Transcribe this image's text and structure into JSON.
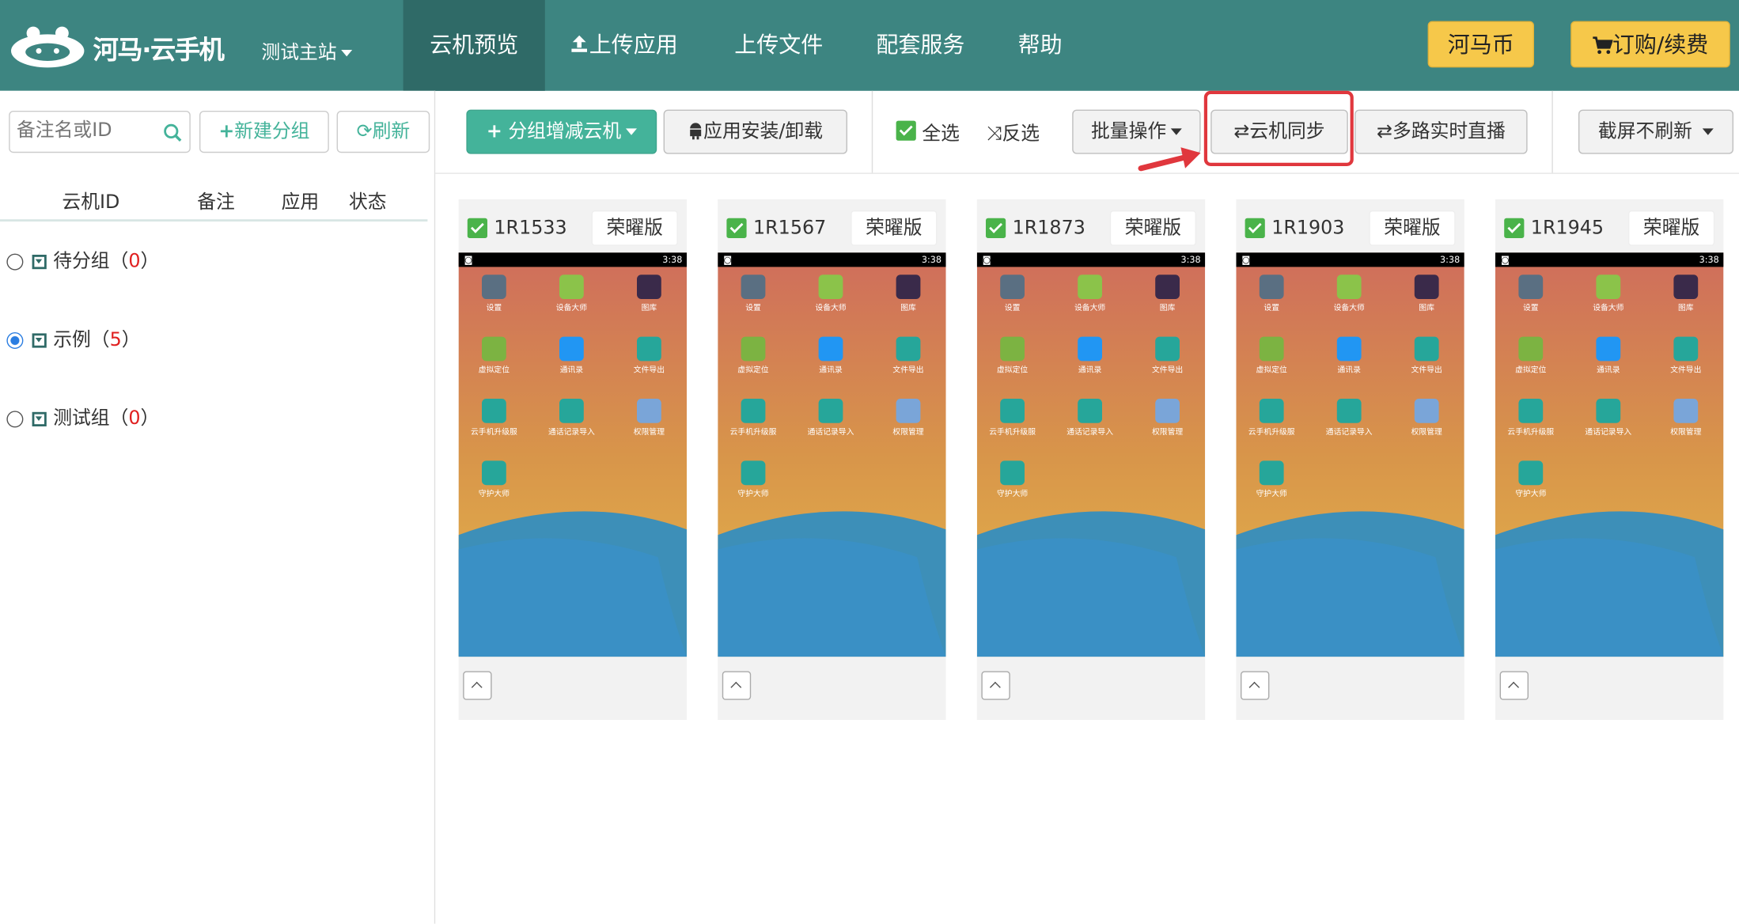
{
  "brand": {
    "logo_text": "河马·云手机",
    "site_selector": "测试主站"
  },
  "nav": [
    {
      "label": "云机预览",
      "active": true
    },
    {
      "label": "上传应用",
      "active": false
    },
    {
      "label": "上传文件",
      "active": false
    },
    {
      "label": "配套服务",
      "active": false
    },
    {
      "label": "帮助",
      "active": false
    }
  ],
  "header_buttons": {
    "coin": "河马币",
    "order": "订购/续费"
  },
  "sidebar": {
    "search_placeholder": "备注名或ID",
    "new_group": "新建分组",
    "refresh": "刷新",
    "columns": [
      "云机ID",
      "备注",
      "应用",
      "状态"
    ],
    "groups": [
      {
        "name": "待分组",
        "count": "0",
        "selected": false
      },
      {
        "name": "示例",
        "count": "5",
        "selected": true
      },
      {
        "name": "测试组",
        "count": "0",
        "selected": false
      }
    ]
  },
  "toolbar": {
    "group_add": "分组增减云机",
    "app_install": "应用安装/卸载",
    "select_all": "全选",
    "invert": "反选",
    "batch": "批量操作",
    "sync": "云机同步",
    "live": "多路实时直播",
    "screenshot": "截屏不刷新"
  },
  "devices": [
    {
      "id": "1R1533",
      "badge": "荣曜版",
      "time": "3:38"
    },
    {
      "id": "1R1567",
      "badge": "荣曜版",
      "time": "3:38"
    },
    {
      "id": "1R1873",
      "badge": "荣曜版",
      "time": "3:38"
    },
    {
      "id": "1R1903",
      "badge": "荣曜版",
      "time": "3:38"
    },
    {
      "id": "1R1945",
      "badge": "荣曜版",
      "time": "3:38"
    }
  ],
  "apps": [
    {
      "label": "设置",
      "icon": "gear-icon",
      "color": "#5a6f82"
    },
    {
      "label": "设备大师",
      "icon": "android-icon",
      "color": "#8bc34a"
    },
    {
      "label": "图库",
      "icon": "gallery-icon",
      "color": "#3a2a4a"
    },
    {
      "label": "虚拟定位",
      "icon": "android-location-icon",
      "color": "#7cb342"
    },
    {
      "label": "通讯录",
      "icon": "contacts-icon",
      "color": "#2196f3"
    },
    {
      "label": "文件导出",
      "icon": "android-icon",
      "color": "#26a69a"
    },
    {
      "label": "云手机升级服",
      "icon": "android-icon",
      "color": "#26a69a"
    },
    {
      "label": "通话记录导入",
      "icon": "android-icon",
      "color": "#26a69a"
    },
    {
      "label": "权限管理",
      "icon": "grid-icon",
      "color": "#7aa5d8"
    },
    {
      "label": "守护大师",
      "icon": "android-icon",
      "color": "#26a69a"
    }
  ]
}
